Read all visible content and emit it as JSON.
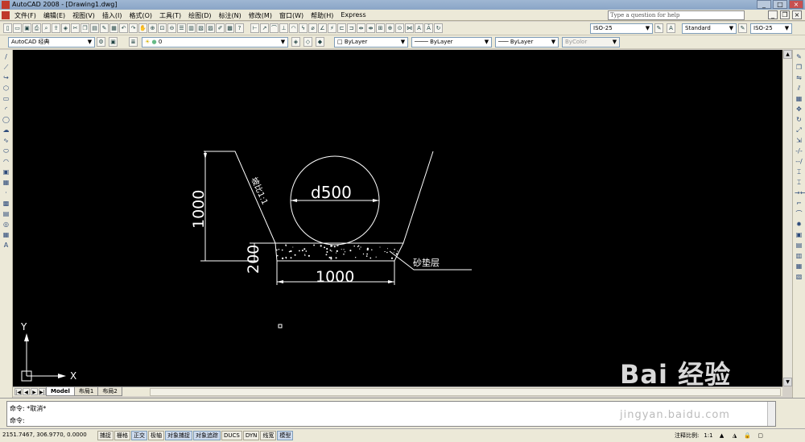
{
  "window": {
    "title": "AutoCAD 2008 - [Drawing1.dwg]",
    "min": "_",
    "max": "□",
    "close": "×"
  },
  "menu": {
    "items": [
      "文件(F)",
      "编辑(E)",
      "视图(V)",
      "插入(I)",
      "格式(O)",
      "工具(T)",
      "绘图(D)",
      "标注(N)",
      "修改(M)",
      "窗口(W)",
      "帮助(H)",
      "Express"
    ],
    "help_placeholder": "Type a question for help"
  },
  "toolbar1": {
    "dimstyle": "ISO-25",
    "textstyle": "Standard",
    "tablestyle": "ISO-25"
  },
  "toolbar2": {
    "workspace": "AutoCAD 经典",
    "layer": "0",
    "color": "ByLayer",
    "linetype": "ByLayer",
    "lineweight": "ByLayer",
    "plotstyle": "ByColor"
  },
  "drawing": {
    "height_dim": "1000",
    "bedding_dim": "200",
    "width_dim": "1000",
    "pipe_label": "d500",
    "slope_label": "坡比1:1",
    "bedding_label": "砂垫层",
    "ucs_x": "X",
    "ucs_y": "Y"
  },
  "layout_tabs": [
    "Model",
    "布局1",
    "布局2"
  ],
  "command": {
    "line1": "命令: *取消*",
    "line2": "命令:"
  },
  "status": {
    "coords": "2151.7467, 306.9770, 0.0000",
    "toggles": [
      {
        "label": "捕捉",
        "on": false
      },
      {
        "label": "栅格",
        "on": false
      },
      {
        "label": "正交",
        "on": true
      },
      {
        "label": "极轴",
        "on": false
      },
      {
        "label": "对象捕捉",
        "on": true
      },
      {
        "label": "对象追踪",
        "on": true
      },
      {
        "label": "DUCS",
        "on": false
      },
      {
        "label": "DYN",
        "on": false
      },
      {
        "label": "线宽",
        "on": false
      },
      {
        "label": "模型",
        "on": true
      }
    ],
    "annotation_scale_label": "注释比例:",
    "annotation_scale": "1:1"
  },
  "watermark": {
    "brand": "Bai 经验",
    "url": "jingyan.baidu.com"
  }
}
